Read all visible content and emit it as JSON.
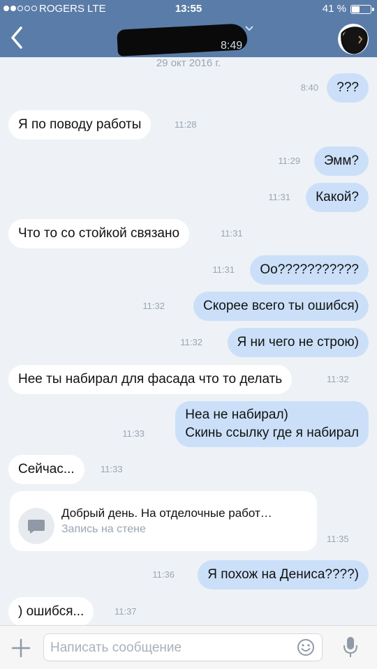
{
  "status": {
    "carrier": "ROGERS  LTE",
    "time": "13:55",
    "battery": "41 %",
    "battery_level": 0.41
  },
  "header": {
    "last_seen_time": "8:49",
    "icons": {
      "back": "back-chevron-icon",
      "expand": "chevron-down-icon",
      "avatar": "contact-avatar"
    }
  },
  "chat": {
    "date": "29 окт 2016 г.",
    "messages": [
      {
        "dir": "out",
        "text": "???",
        "time": "8:40"
      },
      {
        "dir": "in",
        "text": "Я по поводу работы",
        "time": "11:28"
      },
      {
        "dir": "out",
        "text": "Эмм?",
        "time": "11:29"
      },
      {
        "dir": "out",
        "text": "Какой?",
        "time": "11:31"
      },
      {
        "dir": "in",
        "text": "Что то со стойкой связано",
        "time": "11:31"
      },
      {
        "dir": "out",
        "text": "Оо???????????",
        "time": "11:31"
      },
      {
        "dir": "out",
        "text": "Скорее всего ты ошибся)",
        "time": "11:32"
      },
      {
        "dir": "out",
        "text": "Я ни чего не строю)",
        "time": "11:32"
      },
      {
        "dir": "in",
        "text": "Нее ты набирал для фасада что то делать",
        "time": "11:32"
      },
      {
        "dir": "out",
        "lines": [
          "Неа не набирал)",
          "Скинь ссылку где я набирал"
        ],
        "time": "11:33"
      },
      {
        "dir": "in",
        "text": "Сейчас...",
        "time": "11:33"
      },
      {
        "dir": "in",
        "card": {
          "title": "Добрый день. На отделочные работ…",
          "subtitle": "Запись на стене",
          "icon": "wall-post-icon"
        },
        "time": "11:35"
      },
      {
        "dir": "out",
        "text": "Я похож на Дениса????)",
        "time": "11:36"
      },
      {
        "dir": "in",
        "text": ") ошибся...",
        "time": "11:37"
      }
    ]
  },
  "composer": {
    "placeholder": "Написать сообщение",
    "icons": {
      "attach": "plus-icon",
      "emoji": "smile-icon",
      "voice": "microphone-icon"
    }
  },
  "colors": {
    "header": "#5a7ca8",
    "chat_bg": "#eef2f6",
    "outgoing_bubble": "#cbe0f8",
    "incoming_bubble": "#ffffff"
  }
}
